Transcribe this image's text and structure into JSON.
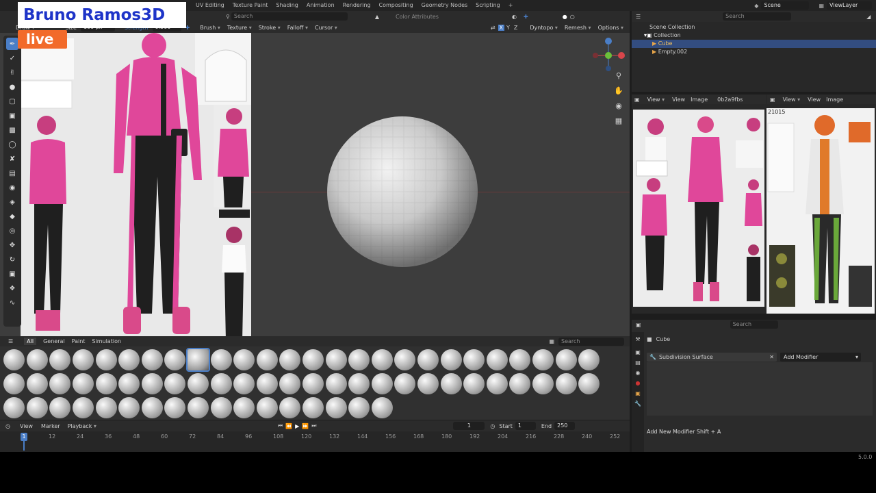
{
  "brand": {
    "name": "Bruno Ramos3D",
    "live": "live"
  },
  "topbar": {
    "tabs": [
      "UV Editing",
      "Texture Paint",
      "Shading",
      "Animation",
      "Rendering",
      "Compositing",
      "Geometry Nodes",
      "Scripting",
      "+"
    ],
    "scene": "Scene",
    "viewlayer": "ViewLayer"
  },
  "header": {
    "search_placeholder": "Search",
    "color_attributes": "Color Attributes"
  },
  "tool_settings": {
    "mode": "Draw",
    "size_label": "Size",
    "size_value": "100 px",
    "strength_label": "Strength",
    "strength_value": "0.500",
    "menus": [
      "Brush",
      "Texture",
      "Stroke",
      "Falloff",
      "Cursor"
    ],
    "axes": [
      "X",
      "Y",
      "Z"
    ],
    "right_menus": [
      "Dyntopo",
      "Remesh",
      "Options"
    ]
  },
  "asset_shelf": {
    "tabs": [
      "All",
      "General",
      "Paint",
      "Simulation"
    ],
    "search_placeholder": "Search"
  },
  "timeline": {
    "menus": [
      "View",
      "Marker",
      "Playback"
    ],
    "current_frame": "1",
    "start_label": "Start",
    "start": "1",
    "end_label": "End",
    "end": "250",
    "ticks": [
      "1",
      "12",
      "24",
      "36",
      "48",
      "60",
      "72",
      "84",
      "96",
      "108",
      "120",
      "132",
      "144",
      "156",
      "168",
      "180",
      "192",
      "204",
      "216",
      "228",
      "240",
      "252"
    ]
  },
  "outliner": {
    "search_placeholder": "Search",
    "items": [
      "Scene Collection",
      "Collection",
      "Cube",
      "Empty.002"
    ]
  },
  "image_editor_1": {
    "menus": [
      "View",
      "View",
      "Image"
    ],
    "image_name": "0b2a9fbs"
  },
  "image_editor_2": {
    "menus": [
      "View",
      "View",
      "Image"
    ],
    "label": "21015"
  },
  "properties": {
    "search_placeholder": "Search",
    "object": "Cube",
    "modifier": "Subdivision Surface",
    "add_modifier": "Add Modifier",
    "hint": "Add New Modifier  Shift + A"
  },
  "version": "5.0.0",
  "colors": {
    "accent": "#4a7ec7",
    "brand_blue": "#1e34c8",
    "live_orange": "#f26a2a",
    "pink": "#e0479a"
  }
}
